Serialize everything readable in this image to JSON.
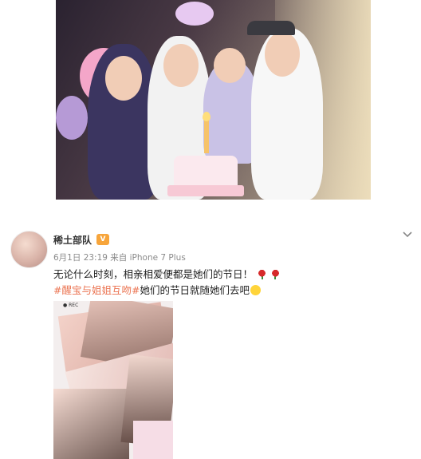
{
  "post": {
    "username": "稀土部队",
    "vip_badge": "V",
    "meta": "6月1日 23:19 来自 iPhone 7 Plus",
    "text_line1": "无论什么时刻，相亲相爱便都是她们的节日！",
    "hashtag": "#醒宝与姐姐互吻#",
    "text_line2_rest": "她们的节日就随她们去吧",
    "collage_rec_label": "● REC"
  },
  "icons": {
    "menu": "chevron-down-icon",
    "badge": "vip-badge-icon",
    "roses": "rose-emoji",
    "laugh": "laughing-emoji"
  },
  "colors": {
    "hashtag": "#eb7350",
    "username": "#333333",
    "meta": "#8a8a8a"
  }
}
